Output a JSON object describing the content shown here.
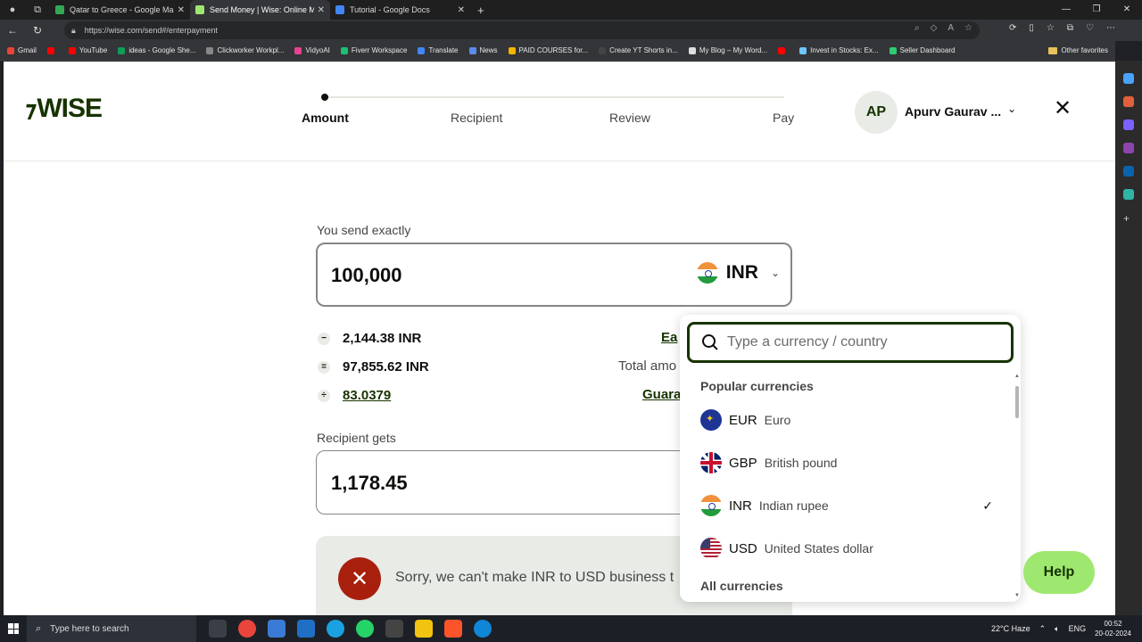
{
  "browser": {
    "tabs": [
      {
        "title": "Qatar to Greece - Google Maps",
        "color": "#34a853",
        "active": false
      },
      {
        "title": "Send Money | Wise: Online Mon",
        "color": "#9fe870",
        "active": true
      },
      {
        "title": "Tutorial - Google Docs",
        "color": "#4285f4",
        "active": false
      }
    ],
    "url": "https://wise.com/send#/enterpayment",
    "bookmarks": [
      {
        "label": "Gmail",
        "color": "#ea4335"
      },
      {
        "label": "",
        "color": "#ff0000"
      },
      {
        "label": "YouTube",
        "color": "#ff0000"
      },
      {
        "label": "ideas - Google She...",
        "color": "#0f9d58"
      },
      {
        "label": "Clickworker Workpl...",
        "color": "#888888"
      },
      {
        "label": "VidyoAI",
        "color": "#e84393"
      },
      {
        "label": "Fiverr Workspace",
        "color": "#1dbf73"
      },
      {
        "label": "Translate",
        "color": "#4285f4"
      },
      {
        "label": "News",
        "color": "#5b8def"
      },
      {
        "label": "PAID COURSES for...",
        "color": "#f4b400"
      },
      {
        "label": "Create YT Shorts in...",
        "color": "#444444"
      },
      {
        "label": "My Blog – My Word...",
        "color": "#dddddd"
      },
      {
        "label": "",
        "color": "#ff0000"
      },
      {
        "label": "Invest in Stocks: Ex...",
        "color": "#6ec6ff"
      },
      {
        "label": "Seller Dashboard",
        "color": "#2ecc71"
      }
    ],
    "other_favorites": "Other favorites"
  },
  "header": {
    "logo": "WISE",
    "steps": [
      "Amount",
      "Recipient",
      "Review",
      "Pay"
    ],
    "active_step": "Amount",
    "avatar_initials": "AP",
    "user_name": "Apurv Gaurav ..."
  },
  "send": {
    "label": "You send exactly",
    "amount": "100,000",
    "currency": "INR"
  },
  "fees": {
    "rows": [
      {
        "op": "−",
        "value": "2,144.38 INR",
        "right": "Ea"
      },
      {
        "op": "=",
        "value": "97,855.62 INR",
        "right": "Total amo"
      },
      {
        "op": "÷",
        "value": "83.0379",
        "right": "Guara"
      }
    ]
  },
  "receive": {
    "label": "Recipient gets",
    "amount": "1,178.45"
  },
  "error": {
    "message": "Sorry, we can't make INR to USD business t"
  },
  "dropdown": {
    "search_placeholder": "Type a currency / country",
    "popular_heading": "Popular currencies",
    "popular": [
      {
        "code": "EUR",
        "name": "Euro",
        "flag": "eu",
        "selected": false
      },
      {
        "code": "GBP",
        "name": "British pound",
        "flag": "gb",
        "selected": false
      },
      {
        "code": "INR",
        "name": "Indian rupee",
        "flag": "in",
        "selected": true
      },
      {
        "code": "USD",
        "name": "United States dollar",
        "flag": "us",
        "selected": false
      }
    ],
    "all_heading": "All currencies"
  },
  "help_label": "Help",
  "taskbar": {
    "search_placeholder": "Type here to search",
    "weather": "22°C  Haze",
    "lang": "ENG",
    "time": "00:52",
    "date": "20-02-2024"
  },
  "colors": {
    "brand_green": "#163300",
    "accent_lime": "#9fe870",
    "error_red": "#a8200d"
  }
}
